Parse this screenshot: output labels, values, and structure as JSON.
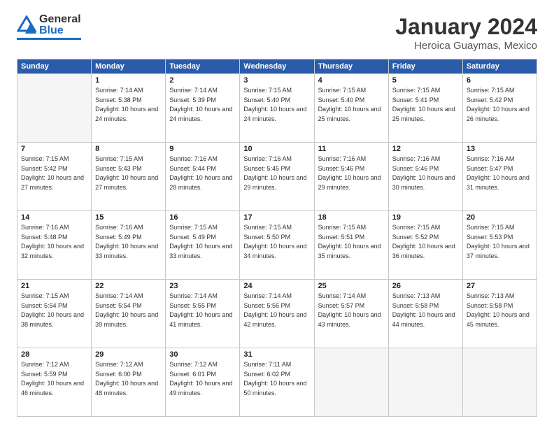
{
  "logo": {
    "general": "General",
    "blue": "Blue"
  },
  "header": {
    "month": "January 2024",
    "location": "Heroica Guaymas, Mexico"
  },
  "weekdays": [
    "Sunday",
    "Monday",
    "Tuesday",
    "Wednesday",
    "Thursday",
    "Friday",
    "Saturday"
  ],
  "weeks": [
    [
      {
        "day": "",
        "sunrise": "",
        "sunset": "",
        "daylight": ""
      },
      {
        "day": "1",
        "sunrise": "Sunrise: 7:14 AM",
        "sunset": "Sunset: 5:38 PM",
        "daylight": "Daylight: 10 hours and 24 minutes."
      },
      {
        "day": "2",
        "sunrise": "Sunrise: 7:14 AM",
        "sunset": "Sunset: 5:39 PM",
        "daylight": "Daylight: 10 hours and 24 minutes."
      },
      {
        "day": "3",
        "sunrise": "Sunrise: 7:15 AM",
        "sunset": "Sunset: 5:40 PM",
        "daylight": "Daylight: 10 hours and 24 minutes."
      },
      {
        "day": "4",
        "sunrise": "Sunrise: 7:15 AM",
        "sunset": "Sunset: 5:40 PM",
        "daylight": "Daylight: 10 hours and 25 minutes."
      },
      {
        "day": "5",
        "sunrise": "Sunrise: 7:15 AM",
        "sunset": "Sunset: 5:41 PM",
        "daylight": "Daylight: 10 hours and 25 minutes."
      },
      {
        "day": "6",
        "sunrise": "Sunrise: 7:15 AM",
        "sunset": "Sunset: 5:42 PM",
        "daylight": "Daylight: 10 hours and 26 minutes."
      }
    ],
    [
      {
        "day": "7",
        "sunrise": "Sunrise: 7:15 AM",
        "sunset": "Sunset: 5:42 PM",
        "daylight": "Daylight: 10 hours and 27 minutes."
      },
      {
        "day": "8",
        "sunrise": "Sunrise: 7:15 AM",
        "sunset": "Sunset: 5:43 PM",
        "daylight": "Daylight: 10 hours and 27 minutes."
      },
      {
        "day": "9",
        "sunrise": "Sunrise: 7:16 AM",
        "sunset": "Sunset: 5:44 PM",
        "daylight": "Daylight: 10 hours and 28 minutes."
      },
      {
        "day": "10",
        "sunrise": "Sunrise: 7:16 AM",
        "sunset": "Sunset: 5:45 PM",
        "daylight": "Daylight: 10 hours and 29 minutes."
      },
      {
        "day": "11",
        "sunrise": "Sunrise: 7:16 AM",
        "sunset": "Sunset: 5:46 PM",
        "daylight": "Daylight: 10 hours and 29 minutes."
      },
      {
        "day": "12",
        "sunrise": "Sunrise: 7:16 AM",
        "sunset": "Sunset: 5:46 PM",
        "daylight": "Daylight: 10 hours and 30 minutes."
      },
      {
        "day": "13",
        "sunrise": "Sunrise: 7:16 AM",
        "sunset": "Sunset: 5:47 PM",
        "daylight": "Daylight: 10 hours and 31 minutes."
      }
    ],
    [
      {
        "day": "14",
        "sunrise": "Sunrise: 7:16 AM",
        "sunset": "Sunset: 5:48 PM",
        "daylight": "Daylight: 10 hours and 32 minutes."
      },
      {
        "day": "15",
        "sunrise": "Sunrise: 7:16 AM",
        "sunset": "Sunset: 5:49 PM",
        "daylight": "Daylight: 10 hours and 33 minutes."
      },
      {
        "day": "16",
        "sunrise": "Sunrise: 7:15 AM",
        "sunset": "Sunset: 5:49 PM",
        "daylight": "Daylight: 10 hours and 33 minutes."
      },
      {
        "day": "17",
        "sunrise": "Sunrise: 7:15 AM",
        "sunset": "Sunset: 5:50 PM",
        "daylight": "Daylight: 10 hours and 34 minutes."
      },
      {
        "day": "18",
        "sunrise": "Sunrise: 7:15 AM",
        "sunset": "Sunset: 5:51 PM",
        "daylight": "Daylight: 10 hours and 35 minutes."
      },
      {
        "day": "19",
        "sunrise": "Sunrise: 7:15 AM",
        "sunset": "Sunset: 5:52 PM",
        "daylight": "Daylight: 10 hours and 36 minutes."
      },
      {
        "day": "20",
        "sunrise": "Sunrise: 7:15 AM",
        "sunset": "Sunset: 5:53 PM",
        "daylight": "Daylight: 10 hours and 37 minutes."
      }
    ],
    [
      {
        "day": "21",
        "sunrise": "Sunrise: 7:15 AM",
        "sunset": "Sunset: 5:54 PM",
        "daylight": "Daylight: 10 hours and 38 minutes."
      },
      {
        "day": "22",
        "sunrise": "Sunrise: 7:14 AM",
        "sunset": "Sunset: 5:54 PM",
        "daylight": "Daylight: 10 hours and 39 minutes."
      },
      {
        "day": "23",
        "sunrise": "Sunrise: 7:14 AM",
        "sunset": "Sunset: 5:55 PM",
        "daylight": "Daylight: 10 hours and 41 minutes."
      },
      {
        "day": "24",
        "sunrise": "Sunrise: 7:14 AM",
        "sunset": "Sunset: 5:56 PM",
        "daylight": "Daylight: 10 hours and 42 minutes."
      },
      {
        "day": "25",
        "sunrise": "Sunrise: 7:14 AM",
        "sunset": "Sunset: 5:57 PM",
        "daylight": "Daylight: 10 hours and 43 minutes."
      },
      {
        "day": "26",
        "sunrise": "Sunrise: 7:13 AM",
        "sunset": "Sunset: 5:58 PM",
        "daylight": "Daylight: 10 hours and 44 minutes."
      },
      {
        "day": "27",
        "sunrise": "Sunrise: 7:13 AM",
        "sunset": "Sunset: 5:58 PM",
        "daylight": "Daylight: 10 hours and 45 minutes."
      }
    ],
    [
      {
        "day": "28",
        "sunrise": "Sunrise: 7:12 AM",
        "sunset": "Sunset: 5:59 PM",
        "daylight": "Daylight: 10 hours and 46 minutes."
      },
      {
        "day": "29",
        "sunrise": "Sunrise: 7:12 AM",
        "sunset": "Sunset: 6:00 PM",
        "daylight": "Daylight: 10 hours and 48 minutes."
      },
      {
        "day": "30",
        "sunrise": "Sunrise: 7:12 AM",
        "sunset": "Sunset: 6:01 PM",
        "daylight": "Daylight: 10 hours and 49 minutes."
      },
      {
        "day": "31",
        "sunrise": "Sunrise: 7:11 AM",
        "sunset": "Sunset: 6:02 PM",
        "daylight": "Daylight: 10 hours and 50 minutes."
      },
      {
        "day": "",
        "sunrise": "",
        "sunset": "",
        "daylight": ""
      },
      {
        "day": "",
        "sunrise": "",
        "sunset": "",
        "daylight": ""
      },
      {
        "day": "",
        "sunrise": "",
        "sunset": "",
        "daylight": ""
      }
    ]
  ]
}
